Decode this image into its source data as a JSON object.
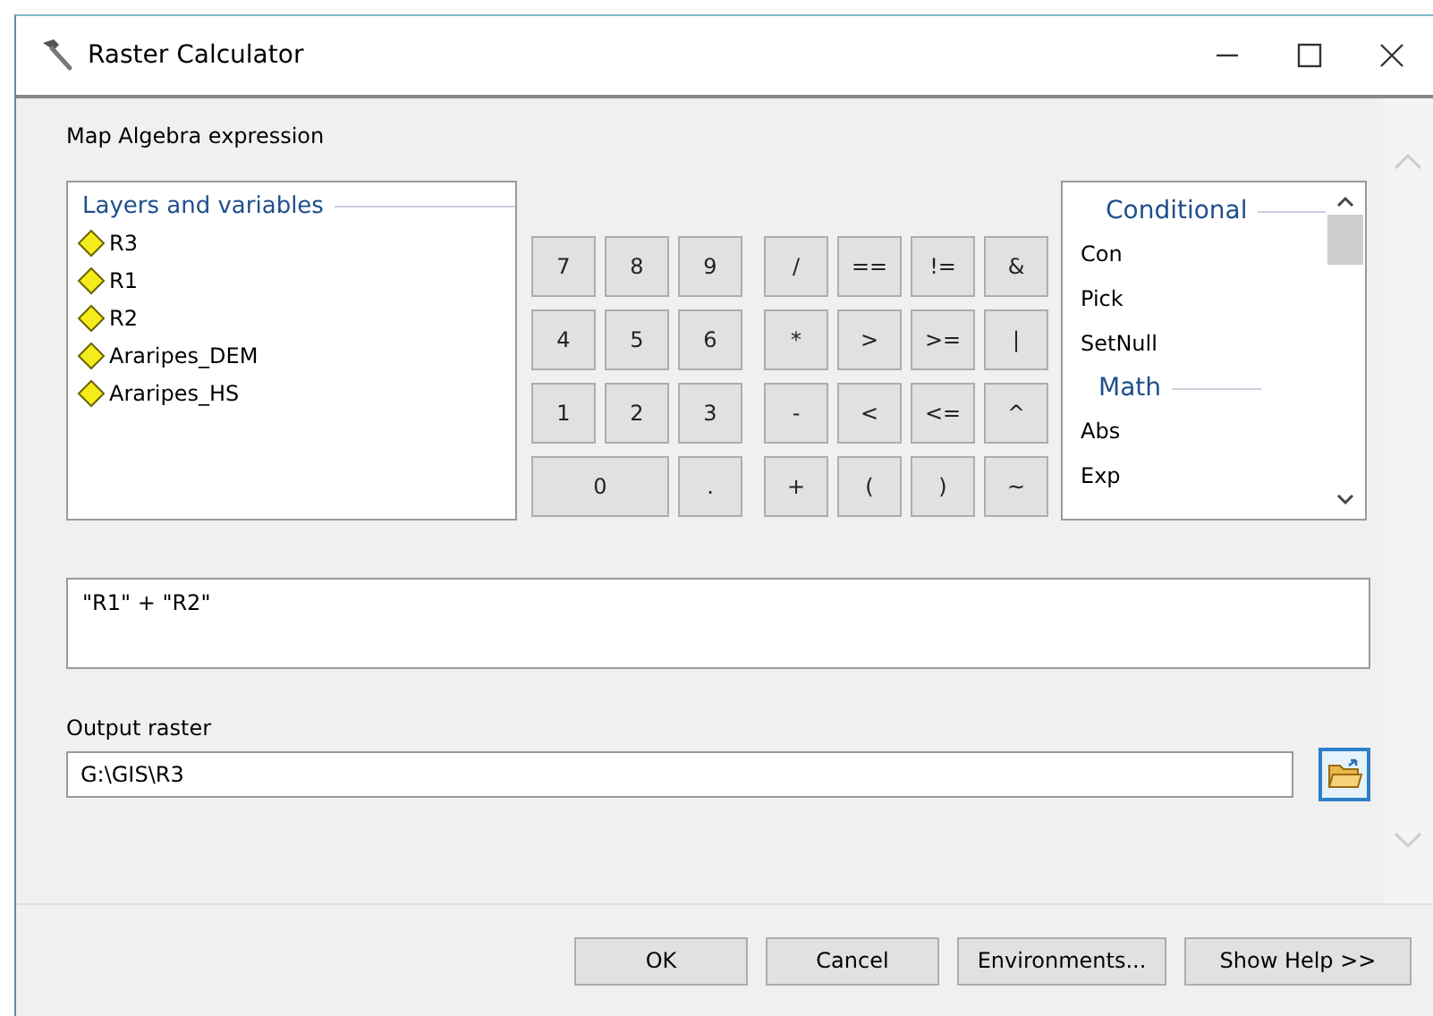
{
  "window": {
    "title": "Raster Calculator"
  },
  "expression_label": "Map Algebra expression",
  "layers": {
    "title": "Layers and variables",
    "items": [
      {
        "name": "R3"
      },
      {
        "name": "R1"
      },
      {
        "name": "R2"
      },
      {
        "name": "Araripes_DEM"
      },
      {
        "name": "Araripes_HS"
      }
    ]
  },
  "keypad": {
    "digits": [
      {
        "label": "7",
        "wide": false
      },
      {
        "label": "8",
        "wide": false
      },
      {
        "label": "9",
        "wide": false
      },
      {
        "label": "4",
        "wide": false
      },
      {
        "label": "5",
        "wide": false
      },
      {
        "label": "6",
        "wide": false
      },
      {
        "label": "1",
        "wide": false
      },
      {
        "label": "2",
        "wide": false
      },
      {
        "label": "3",
        "wide": false
      },
      {
        "label": "0",
        "wide": true
      },
      {
        "label": ".",
        "wide": false
      }
    ],
    "operators": [
      {
        "label": "/"
      },
      {
        "label": "=="
      },
      {
        "label": "!="
      },
      {
        "label": "&"
      },
      {
        "label": "*"
      },
      {
        "label": ">"
      },
      {
        "label": ">="
      },
      {
        "label": "|"
      },
      {
        "label": "-"
      },
      {
        "label": "<"
      },
      {
        "label": "<="
      },
      {
        "label": "^"
      },
      {
        "label": "+"
      },
      {
        "label": "("
      },
      {
        "label": ")"
      },
      {
        "label": "~"
      }
    ]
  },
  "functions": [
    {
      "kind": "header",
      "label": "Conditional"
    },
    {
      "kind": "item",
      "label": "Con"
    },
    {
      "kind": "item",
      "label": "Pick"
    },
    {
      "kind": "item",
      "label": "SetNull"
    },
    {
      "kind": "header",
      "label": "Math"
    },
    {
      "kind": "item",
      "label": "Abs"
    },
    {
      "kind": "item",
      "label": "Exp"
    }
  ],
  "expression": "\"R1\" + \"R2\"",
  "output": {
    "label": "Output raster",
    "value": "G:\\GIS\\R3"
  },
  "buttons": [
    "OK",
    "Cancel",
    "Environments...",
    "Show Help >>"
  ]
}
